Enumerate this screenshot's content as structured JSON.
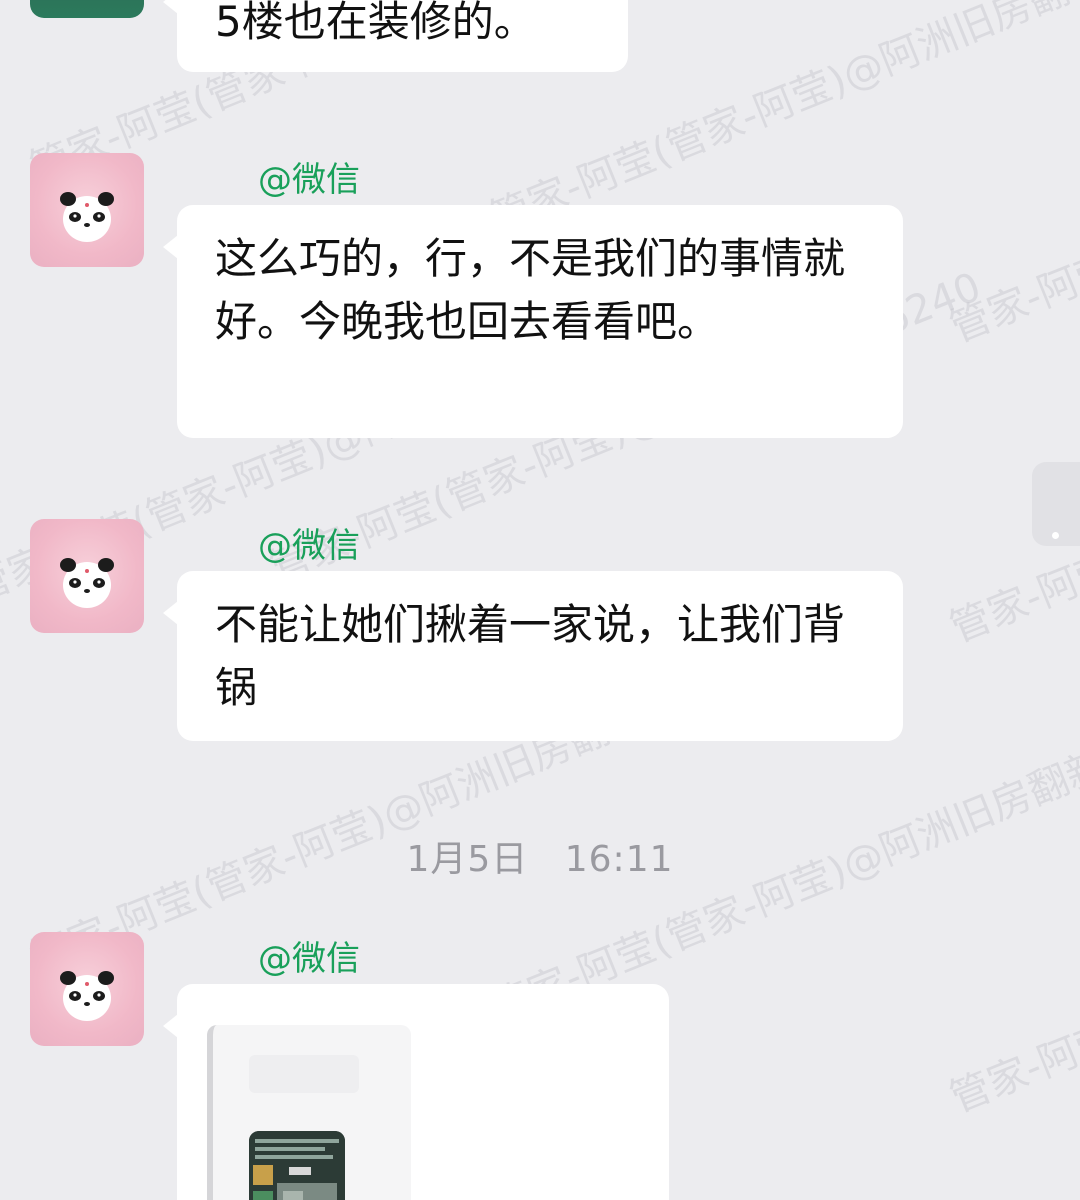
{
  "watermark": "管家-阿莹(管家-阿莹)@阿洲旧房翻新6240",
  "messages": [
    {
      "sender": "",
      "text": "5楼也在装修的。"
    },
    {
      "sender": "@微信",
      "text": "这么巧的，行，不是我们的事情就好。今晚我也回去看看吧。"
    },
    {
      "sender": "@微信",
      "text": "不能让她们揪着一家说，让我们背锅"
    },
    {
      "sender": "@微信",
      "text": ""
    }
  ],
  "timestamp": {
    "date": "1月5日",
    "time": "16:11"
  },
  "colors": {
    "background": "#ececef",
    "bubble": "#ffffff",
    "sender": "#19a05a",
    "timestamp": "#9a9aa0"
  },
  "icons": {
    "avatar": "panda-avatar",
    "card_thumb": "image-thumbnail-icon"
  }
}
